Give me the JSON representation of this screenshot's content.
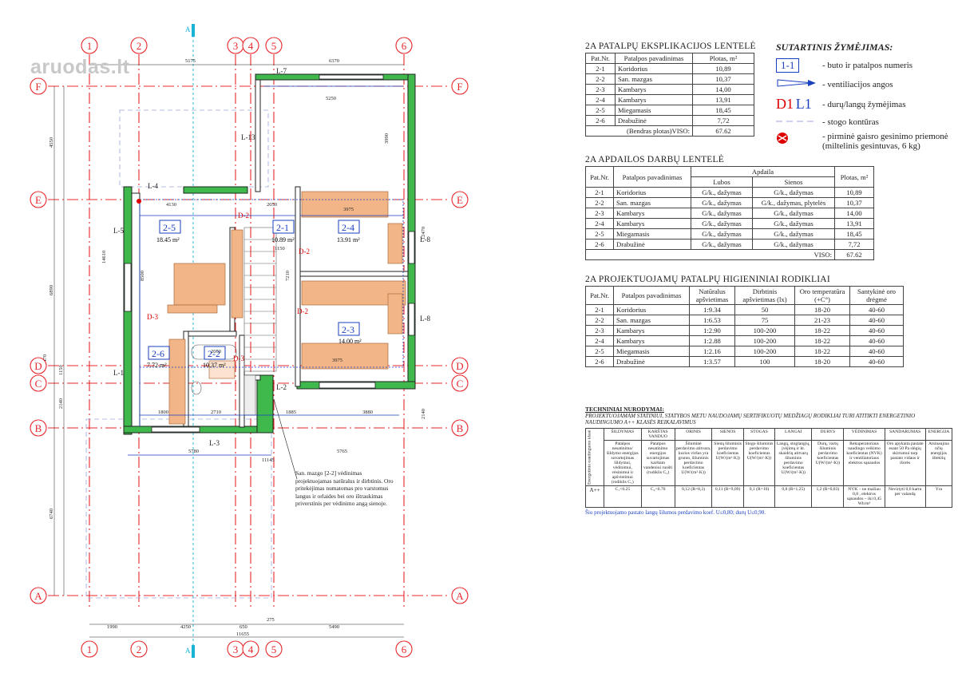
{
  "watermark": "aruodas.lt",
  "grid": {
    "cols": [
      "1",
      "2",
      "3",
      "4",
      "5",
      "6"
    ],
    "rows": [
      "F",
      "E",
      "D",
      "C",
      "B",
      "A"
    ],
    "section_mark": "A"
  },
  "rooms": [
    {
      "id": "2-1",
      "area": "10.89 m²"
    },
    {
      "id": "2-2",
      "area": "10.37 m²"
    },
    {
      "id": "2-3",
      "area": "14.00 m²"
    },
    {
      "id": "2-4",
      "area": "13.91 m²"
    },
    {
      "id": "2-5",
      "area": "18.45 m²"
    },
    {
      "id": "2-6",
      "area": "7.72 m²"
    }
  ],
  "door_labels": [
    "D-2",
    "D-2",
    "D-2",
    "D-3",
    "D-3"
  ],
  "wall_labels": [
    "L-7",
    "L-13",
    "L-4",
    "L-5",
    "L-8",
    "L-8",
    "L-1",
    "L-2",
    "L-3"
  ],
  "dimensions": {
    "top": [
      "5175",
      "6370"
    ],
    "bottom": [
      "1990",
      "4250",
      "650",
      "275",
      "5490",
      "11655"
    ],
    "left": [
      "4550",
      "6890",
      "1150",
      "2140",
      "6740",
      "20470",
      "14610"
    ],
    "inner": [
      "5250",
      "4130",
      "2050",
      "3975",
      "3975",
      "1150",
      "8500",
      "2050",
      "1800",
      "2710",
      "1885",
      "3880",
      "5780",
      "5765",
      "11145",
      "3990",
      "12470",
      "2140",
      "7210"
    ]
  },
  "note": "San. mazgo [2-2] vėdinimas projektuojamas natūralus ir dirbtinis. Oro pritekėjimas numatomas pro varstomus langus ir orlaides bei oro ištraukimas priverstinis per vėdinimo angą sienoje.",
  "table_expl": {
    "title": "2A PATALPŲ EKSPLIKACIJOS LENTELĖ",
    "headers": [
      "Pat.Nr.",
      "Patalpos pavadinimas",
      "Plotas, m²"
    ],
    "rows": [
      [
        "2-1",
        "Koridorius",
        "10,89"
      ],
      [
        "2-2",
        "San. mazgas",
        "10,37"
      ],
      [
        "2-3",
        "Kambarys",
        "14,00"
      ],
      [
        "2-4",
        "Kambarys",
        "13,91"
      ],
      [
        "2-5",
        "Miegamasis",
        "18,45"
      ],
      [
        "2-6",
        "Drabužinė",
        "7,72"
      ]
    ],
    "total_label": "(Bendras plotas)VISO:",
    "total": "67.62"
  },
  "legend": {
    "title": "SUTARTINIS ŽYMĖJIMAS:",
    "items": [
      {
        "sym": "1-1",
        "text": "- buto ir patalpos numeris"
      },
      {
        "sym": "vent-icon",
        "text": "- ventiliacijos angos"
      },
      {
        "sym": "D1 L1",
        "text": "- durų/langų žymėjimas"
      },
      {
        "sym": "dash",
        "text": "- stogo kontūras"
      },
      {
        "sym": "fire-extinguisher-icon",
        "text": "- pirminė gaisro gesinimo priemonė (miltelinis gesintuvas, 6 kg)"
      }
    ]
  },
  "table_finish": {
    "title": "2A APDAILOS DARBŲ LENTELĖ",
    "h_nr": "Pat.Nr.",
    "h_name": "Patalpos pavadinimas",
    "h_group": "Apdaila",
    "h_ceiling": "Lubos",
    "h_walls": "Sienos",
    "h_area": "Plotas, m²",
    "rows": [
      [
        "2-1",
        "Koridorius",
        "G/k., dažymas",
        "G/k., dažymas",
        "10,89"
      ],
      [
        "2-2",
        "San. mazgas",
        "G/k., dažymas",
        "G/k., dažymas, plytelės",
        "10,37"
      ],
      [
        "2-3",
        "Kambarys",
        "G/k., dažymas",
        "G/k., dažymas",
        "14,00"
      ],
      [
        "2-4",
        "Kambarys",
        "G/k., dažymas",
        "G/k., dažymas",
        "13,91"
      ],
      [
        "2-5",
        "Miegamasis",
        "G/k., dažymas",
        "G/k., dažymas",
        "18,45"
      ],
      [
        "2-6",
        "Drabužinė",
        "G/k., dažymas",
        "G/k., dažymas",
        "7,72"
      ]
    ],
    "total_label": "VISO:",
    "total": "67.62"
  },
  "table_hyg": {
    "title": "2A PROJEKTUOJAMŲ PATALPŲ HIGIENINIAI RODIKLIAI",
    "headers": [
      "Pat.Nr.",
      "Patalpos pavadinimas",
      "Natūralus apšvietimas",
      "Dirbtinis apšvietimas (lx)",
      "Oro temperatūra (+C°)",
      "Santykinė oro drėgmė"
    ],
    "rows": [
      [
        "2-1",
        "Koridorius",
        "1:9.34",
        "50",
        "18-20",
        "40-60"
      ],
      [
        "2-2",
        "San. mazgas",
        "1:6.53",
        "75",
        "21-23",
        "40-60"
      ],
      [
        "2-3",
        "Kambarys",
        "1:2.90",
        "100-200",
        "18-22",
        "40-60"
      ],
      [
        "2-4",
        "Kambarys",
        "1:2.88",
        "100-200",
        "18-22",
        "40-60"
      ],
      [
        "2-5",
        "Miegamasis",
        "1:2.16",
        "100-200",
        "18-22",
        "40-60"
      ],
      [
        "2-6",
        "Drabužinė",
        "1:3.57",
        "100",
        "18-20",
        "40-60"
      ]
    ]
  },
  "tech": {
    "title": "TECHNINIAI NURODYMAI:",
    "subtitle": "PROJEKTUOJAMAM STATINIUI, STATYBOS METU NAUDOJAMŲ SERTIFIKUOTŲ MEDŽIAGŲ RODIKLIAI TURI ATITIKTI ENERGETINIO NAUDINGUMO A++ KLASĖS REIKALAVIMUS",
    "row_head": "Energetinio naudingumo klasė",
    "headers": [
      "ŠILDYMAS",
      "KARŠTAS VANDUO",
      "ORINIS",
      "SIENOS",
      "STOGAS",
      "LANGAI",
      "DURYS",
      "VĖDINIMAS",
      "SANDARUMAS",
      "ENERGIJA"
    ],
    "desc": [
      "Patalpos nesatinimo/šildymo energijos suvartojimas šildymui, vėdinimui, vėsinimui ir apšvietimui (rodiklis C₁)",
      "Patalpos nesatinimo energijos suvartojimas karštam vandeniui ruošti (rodiklis C₂)",
      "Šiluminė perdavimo atitvara, kurios viršus yra grunto, šiluminis perdavimo koeficientas U(W/(m²·K))",
      "Sienų šiluminis perdavimo koeficientas U(W/(m²·K))",
      "Stogo šiluminis perdavimo koeficientas U(W/(m²·K))",
      "Langų, stoglangių, įvėjimų ir kt. skaidrių atitvarų šiluminis perdavimo koeficientas U(W/(m²·K))",
      "Durų, vartų šiluminis perdavimo koeficientas U(W/(m²·K))",
      "Rekuperatoriaus naudingo veikimo koeficientas (NVK) ir ventiliatoriaus elektros sąnaudos",
      "Oro apykaita pastate esant 50 Pa slėgių skirtumui tarp pastato vidaus ir išorės",
      "Atsinaujina nčių energijos išteklių"
    ],
    "class": "A++",
    "values": [
      "C₁<0.25",
      "C₂<0.70",
      "0,12 (R=8,3)",
      "0,11 (R=9,09)",
      "0,1 (R=10)",
      "0,8 (R=1,25)",
      "1,2 (R=0,83)",
      "NVK – ne mažiau 0,8 , elektros sąnaudos – iki 0,45 Wh/m³",
      "Nevirtyti 0,6 kartu per valandą",
      "Yra"
    ],
    "footer": "Šio projektuojamo pastato langų šilumos perdavimo koef. U≤0,80; durų U≤0,90."
  },
  "colors": {
    "wall_green": "#3fb94c",
    "red_axis": "#e8282c",
    "blue_dim": "#1a3fbf",
    "furniture": "#f2b587"
  }
}
